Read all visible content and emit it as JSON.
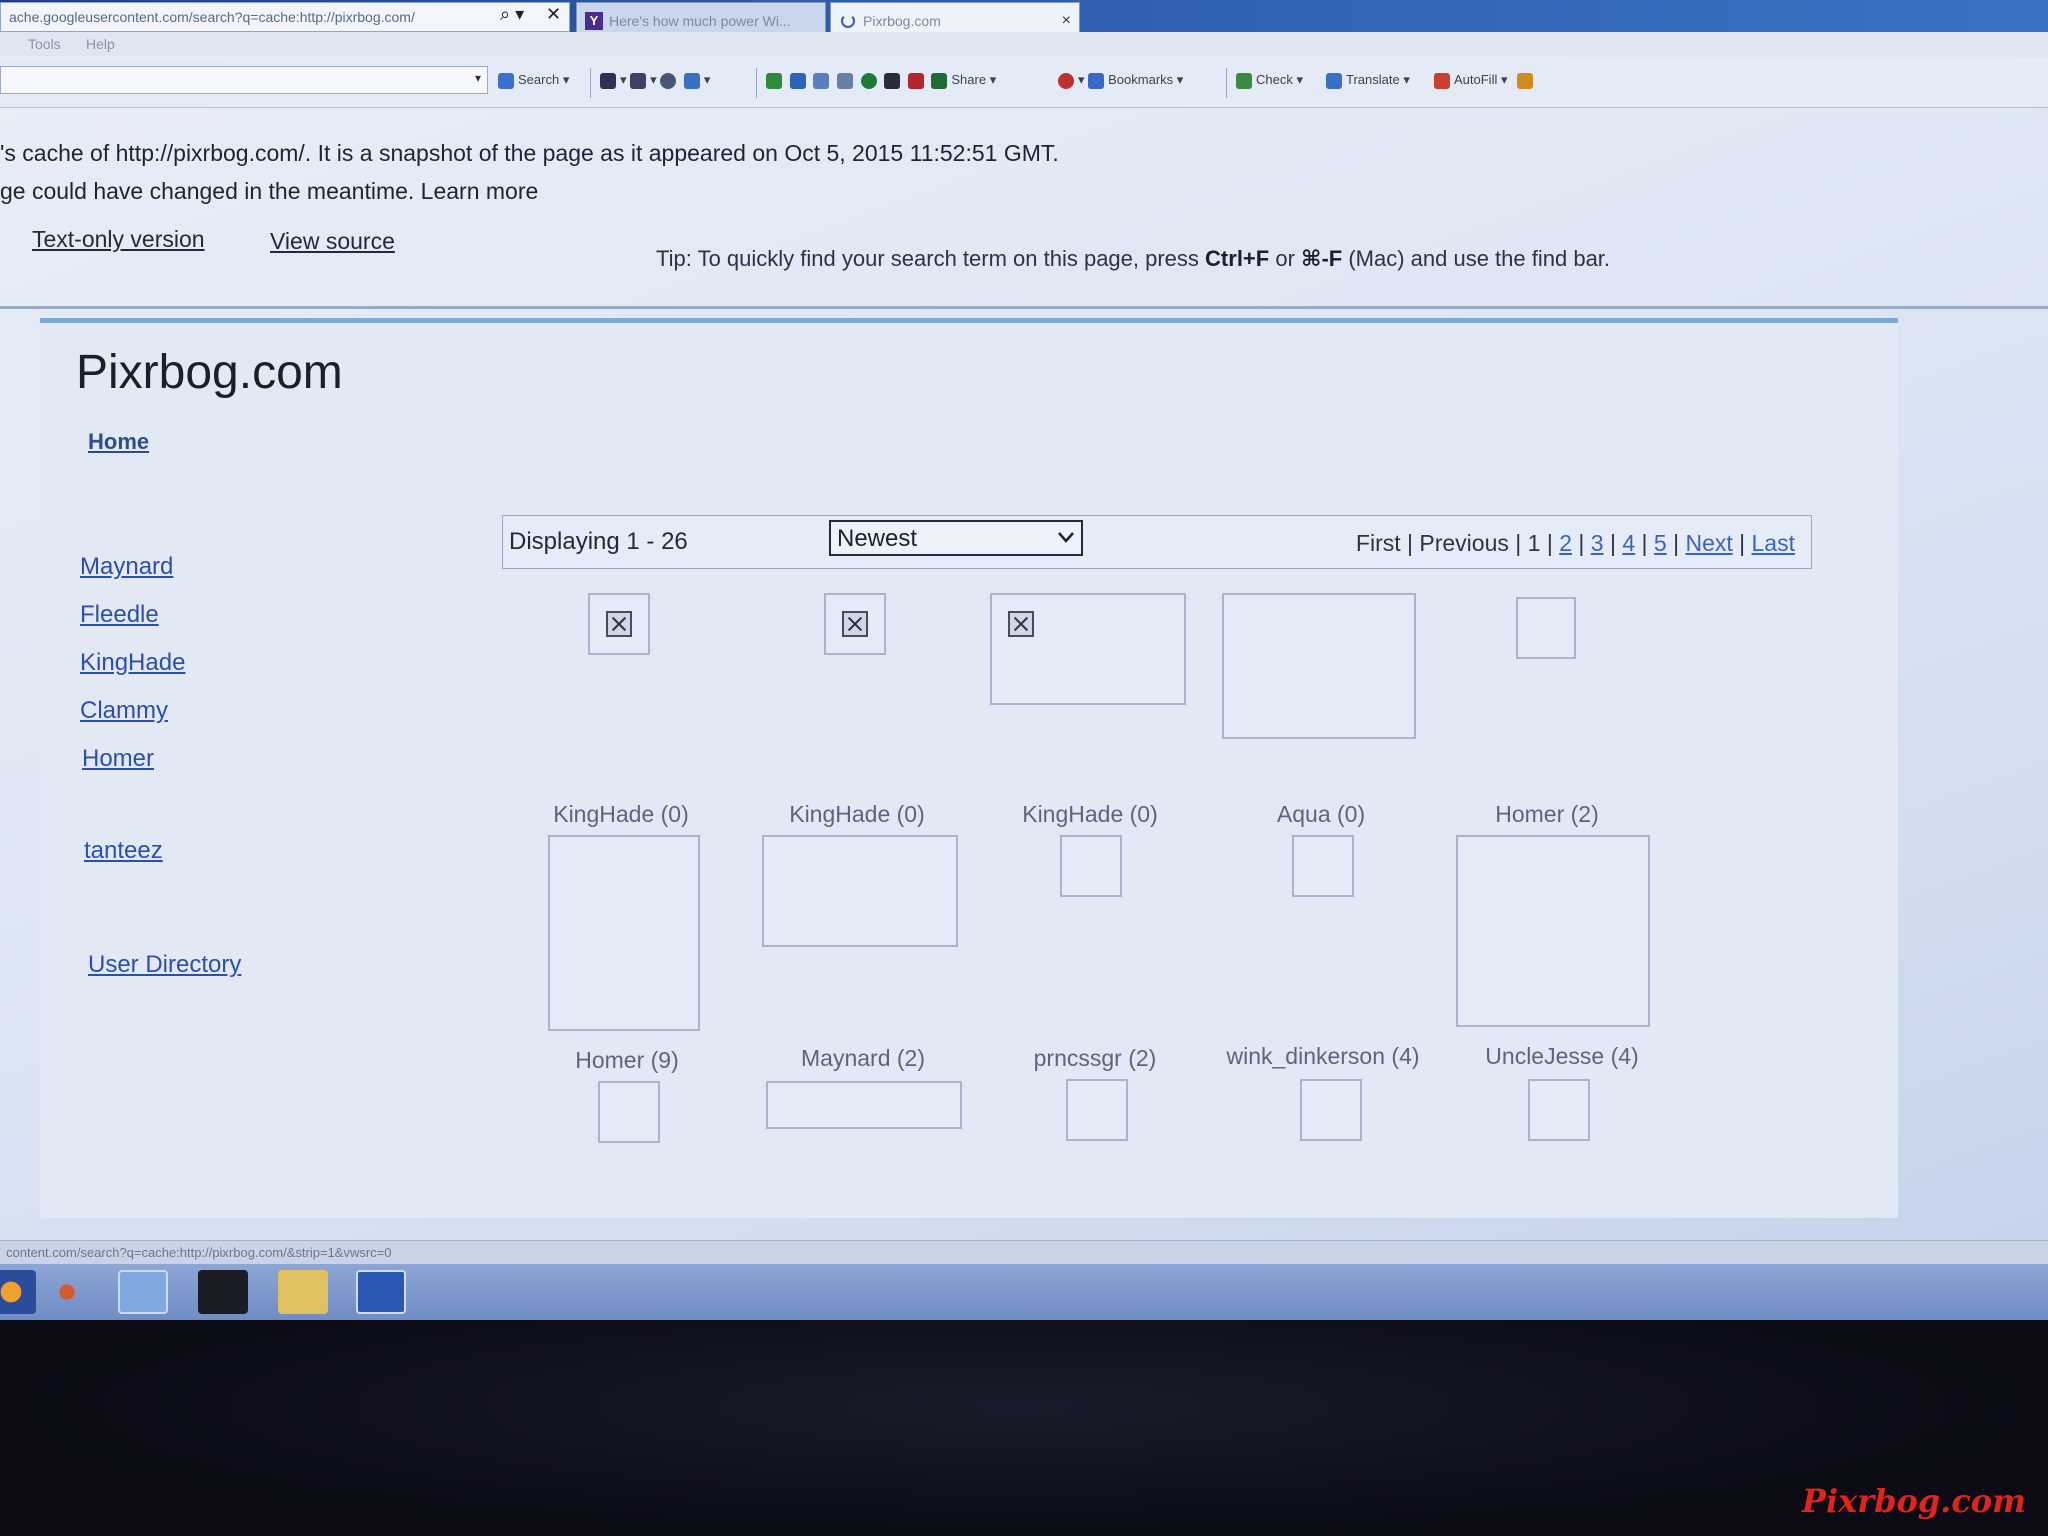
{
  "browser": {
    "address_url": "ache.googleusercontent.com/search?q=cache:http://pixrbog.com/",
    "tabs": [
      {
        "title": "Here's how much power Wi..."
      },
      {
        "title": "Pixrbog.com"
      }
    ],
    "menu": [
      "Tools",
      "Help"
    ],
    "toolbar": {
      "search_label": "Search",
      "share_label": "Share",
      "bookmarks_label": "Bookmarks",
      "check_label": "Check",
      "translate_label": "Translate",
      "autofill_label": "AutoFill"
    }
  },
  "cache": {
    "line1": "'s cache of http://pixrbog.com/. It is a snapshot of the page as it appeared on Oct 5, 2015 11:52:51 GMT.",
    "line2_prefix": "ge could have changed in the meantime. ",
    "learn_more": "Learn more",
    "text_only": "Text-only version",
    "view_source": "View source",
    "tip_prefix": "Tip: To quickly find your search term on this page, press ",
    "tip_key1": "Ctrl+F",
    "tip_or": " or ",
    "tip_key2": "⌘-F",
    "tip_suffix": " (Mac) and use the find bar."
  },
  "site": {
    "title": "Pixrbog.com",
    "nav_home": "Home",
    "side_links": [
      "Maynard",
      "Fleedle",
      "KingHade",
      "Clammy",
      "Homer",
      "tanteez",
      "User Directory"
    ]
  },
  "gallery": {
    "displaying": "Displaying 1 - 26",
    "sort_selected": "Newest",
    "pager": {
      "first": "First",
      "previous": "Previous",
      "current": "1",
      "pages": [
        "2",
        "3",
        "4",
        "5"
      ],
      "next": "Next",
      "last": "Last"
    },
    "captions_row1": [
      "KingHade (0)",
      "KingHade (0)",
      "KingHade (0)",
      "Aqua (0)",
      "Homer (2)"
    ],
    "captions_row2": [
      "Homer (9)",
      "Maynard (2)",
      "prncssgr (2)",
      "wink_dinkerson (4)",
      "UncleJesse (4)"
    ]
  },
  "status": {
    "text": "content.com/search?q=cache:http://pixrbog.com/&strip=1&vwsrc=0"
  },
  "watermark": "Pixrbog.com",
  "colors": {
    "link": "#2a4fb0",
    "accent_border": "#7fa9d8",
    "watermark": "#e2231a"
  }
}
